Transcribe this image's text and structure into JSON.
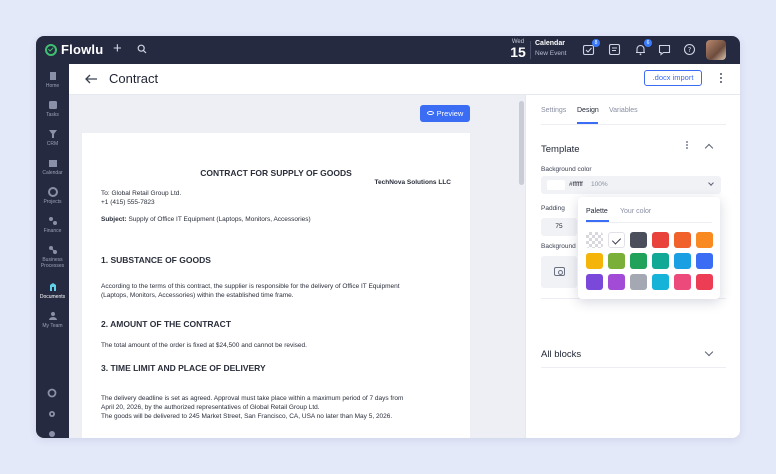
{
  "app": {
    "logo": "Flowlu",
    "date": {
      "dow": "Wed",
      "day": "15"
    },
    "calendar": {
      "title": "Calendar",
      "subtitle": "New Event"
    },
    "badges": {
      "tasks": "8",
      "notifications": "6"
    }
  },
  "sidebar": {
    "items": [
      {
        "label": "Home",
        "icon": "home-icon"
      },
      {
        "label": "Tasks",
        "icon": "tasks-icon"
      },
      {
        "label": "CRM",
        "icon": "crm-icon"
      },
      {
        "label": "Calendar",
        "icon": "calendar-icon"
      },
      {
        "label": "Projects",
        "icon": "projects-icon"
      },
      {
        "label": "Finance",
        "icon": "finance-icon"
      },
      {
        "label": "Business",
        "label2": "Processes",
        "icon": "processes-icon"
      },
      {
        "label": "Documents",
        "icon": "documents-icon",
        "active": true
      },
      {
        "label": "My Team",
        "icon": "team-icon"
      }
    ]
  },
  "header": {
    "title": "Contract",
    "docx_import": ".docx import"
  },
  "editor": {
    "preview_label": "Preview"
  },
  "document": {
    "title": "CONTRACT FOR SUPPLY OF GOODS",
    "company": "TechNova Solutions LLC",
    "to": "To: Global Retail Group Ltd.",
    "phone": "+1 (415) 555-7823",
    "subject_label": "Subject:",
    "subject": "Supply of Office IT Equipment (Laptops, Monitors, Accessories)",
    "s1_heading": "1. SUBSTANCE OF GOODS",
    "s1_line1": "According to the terms of this contract, the supplier is responsible for the delivery of Office IT Equipment",
    "s1_line2": "(Laptops, Monitors, Accessories) within the established time frame.",
    "s2_heading": "2. AMOUNT OF THE CONTRACT",
    "s2_line1": "The total amount of the order is fixed at $24,500 and cannot be revised.",
    "s3_heading": "3. TIME LIMIT AND PLACE OF DELIVERY",
    "s3_line1": "The delivery deadline is set as agreed. Approval must take place within a maximum period of 7 days from",
    "s3_line2": "April 20, 2026, by the authorized representatives of Global Retail Group Ltd.",
    "s3_line3": "The goods will be delivered to 245 Market Street, San Francisco, CA, USA no later than May 5, 2026."
  },
  "panel": {
    "tabs": [
      "Settings",
      "Design",
      "Variables"
    ],
    "active_tab": "Design",
    "section_title": "Template",
    "bg_color_label": "Background color",
    "bg_color_value": "#ffffff",
    "bg_color_opacity": "100%",
    "padding_label": "Padding",
    "padding_value": "75",
    "bg_image_label": "Background",
    "all_blocks": "All blocks"
  },
  "palette": {
    "tabs": [
      "Palette",
      "Your color"
    ],
    "active_tab": "Palette",
    "selected": "#ffffff",
    "colors": [
      [
        "transparent",
        "#ffffff",
        "#4b4f5c",
        "#e8423b",
        "#f0612c",
        "#f98a21"
      ],
      [
        "#f5b40a",
        "#7ab03a",
        "#21a25a",
        "#12a896",
        "#1aa0e2",
        "#3a6cf4"
      ],
      [
        "#7b49d9",
        "#a24bd6",
        "#a3a8b3",
        "#16b3d9",
        "#ec4a7a",
        "#ec3d54"
      ]
    ]
  }
}
